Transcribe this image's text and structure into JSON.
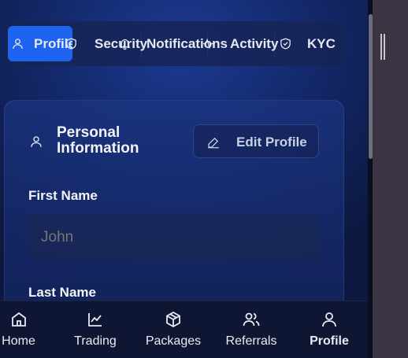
{
  "tabs": [
    {
      "label": "Profile",
      "icon": "user-icon",
      "active": true
    },
    {
      "label": "Security",
      "icon": "shield-icon"
    },
    {
      "label": "Notifications",
      "icon": "bell-icon"
    },
    {
      "label": "Activity",
      "icon": "activity-icon"
    },
    {
      "label": "KYC",
      "icon": "shield-check-icon"
    }
  ],
  "card": {
    "title": "Personal Information",
    "edit_label": "Edit Profile",
    "fields": [
      {
        "label": "First Name",
        "placeholder": "John"
      },
      {
        "label": "Last Name",
        "placeholder": ""
      }
    ]
  },
  "bottom_nav": [
    {
      "label": "Home",
      "icon": "home-icon"
    },
    {
      "label": "Trading",
      "icon": "chart-icon"
    },
    {
      "label": "Packages",
      "icon": "package-icon"
    },
    {
      "label": "Referrals",
      "icon": "users-icon"
    },
    {
      "label": "Profile",
      "icon": "user-icon",
      "active": true
    }
  ],
  "colors": {
    "accent": "#1e63f0",
    "background": "#152b70",
    "nav_background": "#0f1633"
  }
}
